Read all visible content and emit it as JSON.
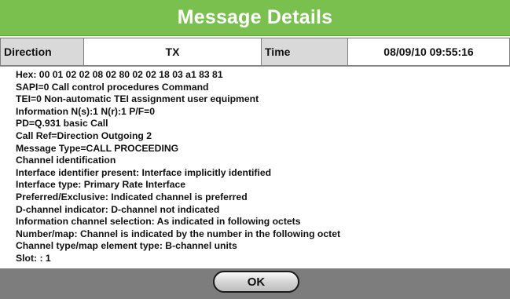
{
  "dialog": {
    "title": "Message Details"
  },
  "info": {
    "direction_label": "Direction",
    "direction_value": "TX",
    "time_label": "Time",
    "time_value": "08/09/10 09:55:16"
  },
  "details": {
    "lines": [
      "Hex:  00 01 02 02 08 02 80 02 02 18 03 a1 83 81",
      "SAPI=0 Call control procedures Command",
      "TEI=0 Non-automatic TEI assignment user equipment",
      "Information N(s):1 N(r):1 P/F=0",
      "PD=Q.931 basic Call",
      "Call Ref=Direction Outgoing 2",
      "Message Type=CALL PROCEEDING",
      "Channel identification",
      "Interface identifier present: Interface implicitly identified",
      "Interface type: Primary Rate Interface",
      "Preferred/Exclusive: Indicated channel is preferred",
      "D-channel indicator: D-channel not indicated",
      "Information channel selection: As indicated in following octets",
      "Number/map: Channel is indicated by the number in the following octet",
      "Channel type/map element type: B-channel units",
      "Slot: : 1"
    ]
  },
  "footer": {
    "ok_label": "OK"
  },
  "colors": {
    "title_bar": "#79c04f",
    "footer_bar": "#7d7d7d",
    "label_cell": "#d9d9d9"
  }
}
